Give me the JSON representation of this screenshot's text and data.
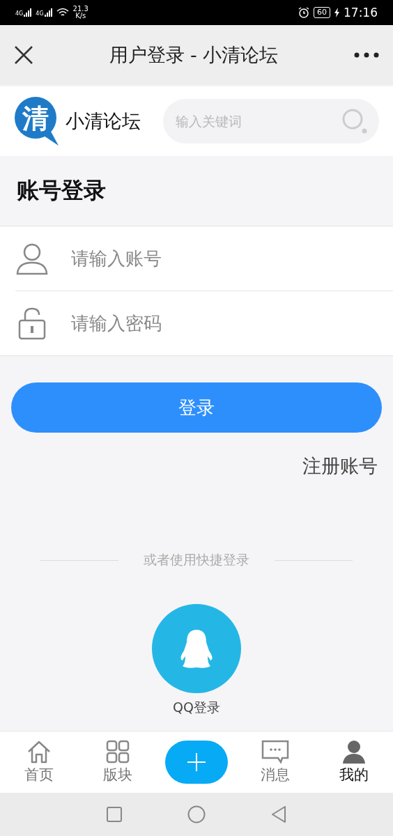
{
  "status_bar": {
    "signal_1": "4G",
    "signal_2": "4G",
    "speed": "21.3",
    "speed_unit": "K/s",
    "battery": "60",
    "time": "17:16"
  },
  "title_bar": {
    "title": "用户登录 - 小清论坛"
  },
  "header": {
    "logo_glyph": "清",
    "site_name": "小清论坛",
    "search": {
      "placeholder": "输入关键词"
    }
  },
  "section_title": "账号登录",
  "fields": [
    {
      "kind": "user",
      "placeholder": "请输入账号"
    },
    {
      "kind": "lock",
      "placeholder": "请输入密码"
    }
  ],
  "login_button": "登录",
  "register_link": "注册账号",
  "divider_text": "或者使用快捷登录",
  "quick_login": {
    "label": "QQ登录"
  },
  "tabs": [
    {
      "kind": "home",
      "label": "首页",
      "selected": false
    },
    {
      "kind": "grid",
      "label": "版块",
      "selected": false
    },
    {
      "kind": "plus",
      "selected": false
    },
    {
      "kind": "chat",
      "label": "消息",
      "selected": false
    },
    {
      "kind": "person",
      "label": "我的",
      "selected": true
    }
  ]
}
